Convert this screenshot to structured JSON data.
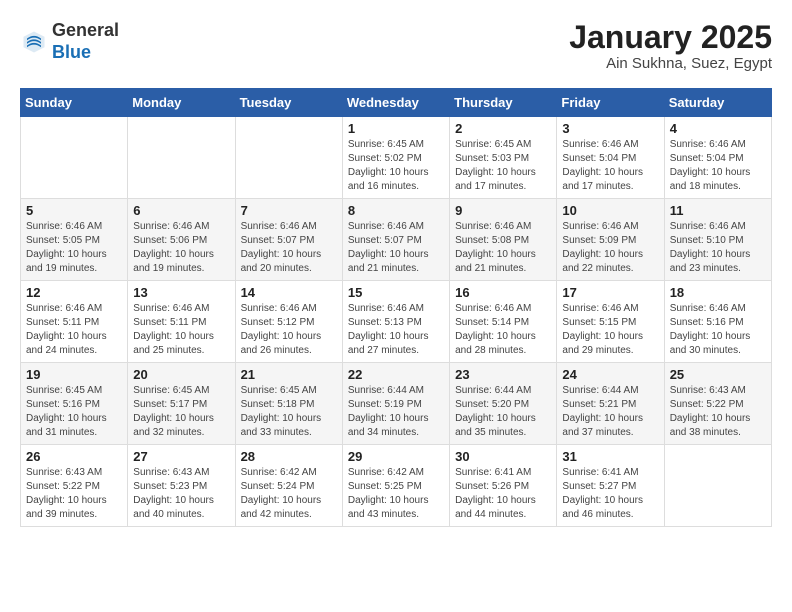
{
  "header": {
    "logo_general": "General",
    "logo_blue": "Blue",
    "title": "January 2025",
    "subtitle": "Ain Sukhna, Suez, Egypt"
  },
  "days_of_week": [
    "Sunday",
    "Monday",
    "Tuesday",
    "Wednesday",
    "Thursday",
    "Friday",
    "Saturday"
  ],
  "weeks": [
    [
      {
        "day": "",
        "info": ""
      },
      {
        "day": "",
        "info": ""
      },
      {
        "day": "",
        "info": ""
      },
      {
        "day": "1",
        "info": "Sunrise: 6:45 AM\nSunset: 5:02 PM\nDaylight: 10 hours\nand 16 minutes."
      },
      {
        "day": "2",
        "info": "Sunrise: 6:45 AM\nSunset: 5:03 PM\nDaylight: 10 hours\nand 17 minutes."
      },
      {
        "day": "3",
        "info": "Sunrise: 6:46 AM\nSunset: 5:04 PM\nDaylight: 10 hours\nand 17 minutes."
      },
      {
        "day": "4",
        "info": "Sunrise: 6:46 AM\nSunset: 5:04 PM\nDaylight: 10 hours\nand 18 minutes."
      }
    ],
    [
      {
        "day": "5",
        "info": "Sunrise: 6:46 AM\nSunset: 5:05 PM\nDaylight: 10 hours\nand 19 minutes."
      },
      {
        "day": "6",
        "info": "Sunrise: 6:46 AM\nSunset: 5:06 PM\nDaylight: 10 hours\nand 19 minutes."
      },
      {
        "day": "7",
        "info": "Sunrise: 6:46 AM\nSunset: 5:07 PM\nDaylight: 10 hours\nand 20 minutes."
      },
      {
        "day": "8",
        "info": "Sunrise: 6:46 AM\nSunset: 5:07 PM\nDaylight: 10 hours\nand 21 minutes."
      },
      {
        "day": "9",
        "info": "Sunrise: 6:46 AM\nSunset: 5:08 PM\nDaylight: 10 hours\nand 21 minutes."
      },
      {
        "day": "10",
        "info": "Sunrise: 6:46 AM\nSunset: 5:09 PM\nDaylight: 10 hours\nand 22 minutes."
      },
      {
        "day": "11",
        "info": "Sunrise: 6:46 AM\nSunset: 5:10 PM\nDaylight: 10 hours\nand 23 minutes."
      }
    ],
    [
      {
        "day": "12",
        "info": "Sunrise: 6:46 AM\nSunset: 5:11 PM\nDaylight: 10 hours\nand 24 minutes."
      },
      {
        "day": "13",
        "info": "Sunrise: 6:46 AM\nSunset: 5:11 PM\nDaylight: 10 hours\nand 25 minutes."
      },
      {
        "day": "14",
        "info": "Sunrise: 6:46 AM\nSunset: 5:12 PM\nDaylight: 10 hours\nand 26 minutes."
      },
      {
        "day": "15",
        "info": "Sunrise: 6:46 AM\nSunset: 5:13 PM\nDaylight: 10 hours\nand 27 minutes."
      },
      {
        "day": "16",
        "info": "Sunrise: 6:46 AM\nSunset: 5:14 PM\nDaylight: 10 hours\nand 28 minutes."
      },
      {
        "day": "17",
        "info": "Sunrise: 6:46 AM\nSunset: 5:15 PM\nDaylight: 10 hours\nand 29 minutes."
      },
      {
        "day": "18",
        "info": "Sunrise: 6:46 AM\nSunset: 5:16 PM\nDaylight: 10 hours\nand 30 minutes."
      }
    ],
    [
      {
        "day": "19",
        "info": "Sunrise: 6:45 AM\nSunset: 5:16 PM\nDaylight: 10 hours\nand 31 minutes."
      },
      {
        "day": "20",
        "info": "Sunrise: 6:45 AM\nSunset: 5:17 PM\nDaylight: 10 hours\nand 32 minutes."
      },
      {
        "day": "21",
        "info": "Sunrise: 6:45 AM\nSunset: 5:18 PM\nDaylight: 10 hours\nand 33 minutes."
      },
      {
        "day": "22",
        "info": "Sunrise: 6:44 AM\nSunset: 5:19 PM\nDaylight: 10 hours\nand 34 minutes."
      },
      {
        "day": "23",
        "info": "Sunrise: 6:44 AM\nSunset: 5:20 PM\nDaylight: 10 hours\nand 35 minutes."
      },
      {
        "day": "24",
        "info": "Sunrise: 6:44 AM\nSunset: 5:21 PM\nDaylight: 10 hours\nand 37 minutes."
      },
      {
        "day": "25",
        "info": "Sunrise: 6:43 AM\nSunset: 5:22 PM\nDaylight: 10 hours\nand 38 minutes."
      }
    ],
    [
      {
        "day": "26",
        "info": "Sunrise: 6:43 AM\nSunset: 5:22 PM\nDaylight: 10 hours\nand 39 minutes."
      },
      {
        "day": "27",
        "info": "Sunrise: 6:43 AM\nSunset: 5:23 PM\nDaylight: 10 hours\nand 40 minutes."
      },
      {
        "day": "28",
        "info": "Sunrise: 6:42 AM\nSunset: 5:24 PM\nDaylight: 10 hours\nand 42 minutes."
      },
      {
        "day": "29",
        "info": "Sunrise: 6:42 AM\nSunset: 5:25 PM\nDaylight: 10 hours\nand 43 minutes."
      },
      {
        "day": "30",
        "info": "Sunrise: 6:41 AM\nSunset: 5:26 PM\nDaylight: 10 hours\nand 44 minutes."
      },
      {
        "day": "31",
        "info": "Sunrise: 6:41 AM\nSunset: 5:27 PM\nDaylight: 10 hours\nand 46 minutes."
      },
      {
        "day": "",
        "info": ""
      }
    ]
  ]
}
